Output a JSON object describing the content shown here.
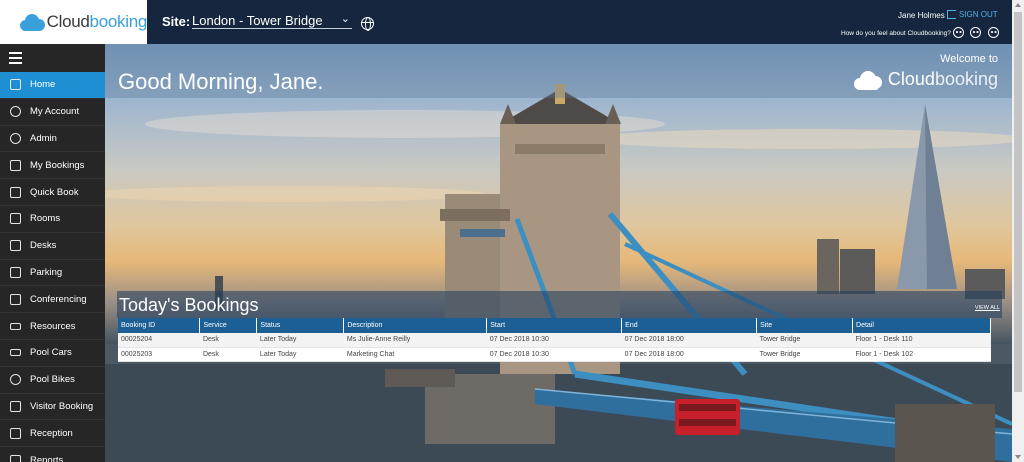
{
  "header": {
    "logo_text": "Cloudbooking",
    "logo_text_a": "Cloud",
    "logo_text_b": "booking",
    "site_label": "Site:",
    "site_value": "London - Tower Bridge",
    "user_name": "Jane Holmes",
    "signout_label": "SIGN OUT",
    "feel_question": "How do you feel about Cloudbooking?"
  },
  "sidebar": {
    "items": [
      {
        "label": "Home",
        "icon": "home-icon",
        "active": true
      },
      {
        "label": "My Account",
        "icon": "user-icon"
      },
      {
        "label": "Admin",
        "icon": "gear-icon"
      },
      {
        "label": "My Bookings",
        "icon": "calendar-icon"
      },
      {
        "label": "Quick Book",
        "icon": "lightning-icon"
      },
      {
        "label": "Rooms",
        "icon": "rooms-icon"
      },
      {
        "label": "Desks",
        "icon": "desk-icon"
      },
      {
        "label": "Parking",
        "icon": "parking-icon"
      },
      {
        "label": "Conferencing",
        "icon": "monitor-icon"
      },
      {
        "label": "Resources",
        "icon": "projector-icon"
      },
      {
        "label": "Pool Cars",
        "icon": "car-icon"
      },
      {
        "label": "Pool Bikes",
        "icon": "bike-icon"
      },
      {
        "label": "Visitor Booking",
        "icon": "visitor-icon"
      },
      {
        "label": "Reception",
        "icon": "reception-icon"
      },
      {
        "label": "Reports",
        "icon": "reports-icon"
      }
    ]
  },
  "hero": {
    "greeting": "Good Morning, Jane.",
    "welcome": "Welcome to",
    "logo_a": "Cloud",
    "logo_b": "booking"
  },
  "bookings": {
    "title": "Today's Bookings",
    "view_all": "VIEW ALL",
    "columns": [
      "Booking ID",
      "Service",
      "Status",
      "Description",
      "Start",
      "End",
      "Site",
      "Detail"
    ],
    "rows": [
      [
        "00025204",
        "Desk",
        "Later Today",
        "Ms Julie-Anne Reilly",
        "07 Dec 2018 10:30",
        "07 Dec 2018 18:00",
        "Tower Bridge",
        "Floor 1 - Desk 110"
      ],
      [
        "00025203",
        "Desk",
        "Later Today",
        "Marketing Chat",
        "07 Dec 2018 10:30",
        "07 Dec 2018 18:00",
        "Tower Bridge",
        "Floor 1 - Desk 102"
      ]
    ]
  },
  "colors": {
    "header_bg": "#15263e",
    "accent": "#1e8fd2",
    "sidebar_bg": "#262626",
    "table_header": "#1c5f94"
  }
}
